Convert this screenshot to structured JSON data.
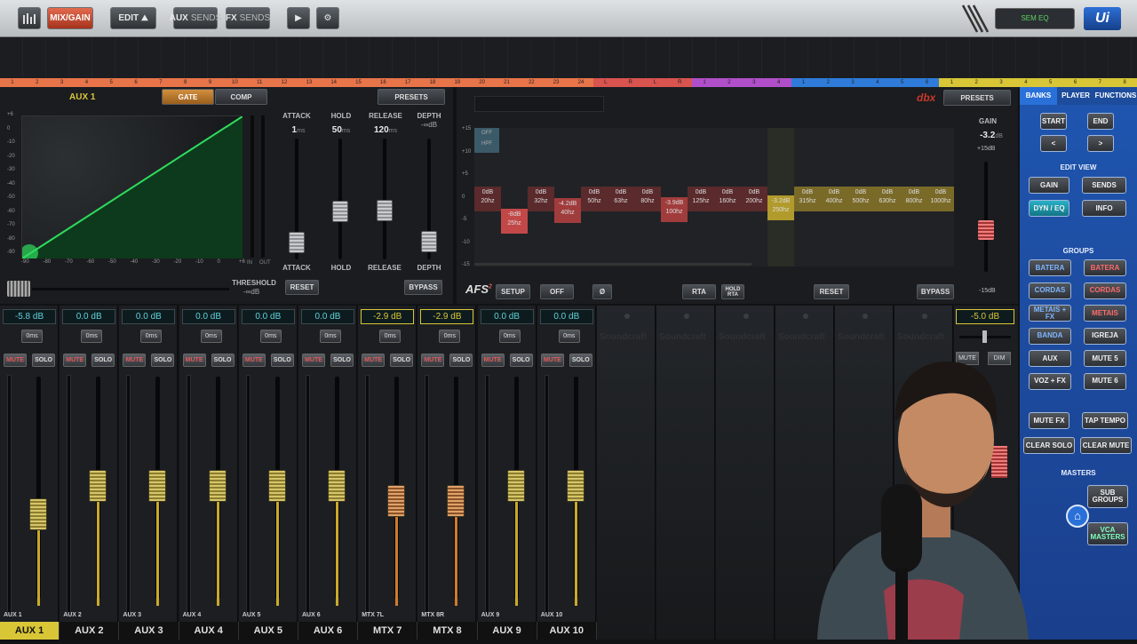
{
  "topbar": {
    "mix_label": "MIX/GAIN",
    "edit_label": "EDIT",
    "aux_label": "AUX",
    "aux_sends_label": "SENDS",
    "fx_label": "FX",
    "fx_sends_label": "SENDS",
    "scene_label": "SEM EQ",
    "logo": "Ui"
  },
  "channel_numbers": [
    "1",
    "2",
    "3",
    "4",
    "5",
    "6",
    "7",
    "8",
    "9",
    "10",
    "11",
    "12",
    "13",
    "14",
    "15",
    "16",
    "17",
    "18",
    "19",
    "20",
    "21",
    "22",
    "23",
    "24",
    "L",
    "R",
    "L",
    "R",
    "1",
    "2",
    "3",
    "4",
    "1",
    "2",
    "3",
    "4",
    "5",
    "6",
    "1",
    "2",
    "3",
    "4",
    "5",
    "6",
    "7",
    "8"
  ],
  "dynamics": {
    "channel_title": "AUX 1",
    "tab_gate": "GATE",
    "tab_comp": "COMP",
    "presets": "PRESETS",
    "y_ticks": [
      "+6",
      "0",
      "-10",
      "-20",
      "-30",
      "-40",
      "-50",
      "-60",
      "-70",
      "-80",
      "-90"
    ],
    "x_ticks": [
      "-90",
      "-80",
      "-70",
      "-60",
      "-50",
      "-40",
      "-30",
      "-20",
      "-10",
      "0",
      "+6"
    ],
    "in_label": "IN",
    "out_label": "OUT",
    "attack": {
      "label": "ATTACK",
      "value": "1",
      "unit": "ms"
    },
    "hold": {
      "label": "HOLD",
      "value": "50",
      "unit": "ms"
    },
    "release": {
      "label": "RELEASE",
      "value": "120",
      "unit": "ms"
    },
    "depth": {
      "label": "DEPTH",
      "value": "-∞",
      "unit": "dB"
    },
    "threshold": {
      "label": "THRESHOLD",
      "value": "-∞",
      "unit": "dB"
    },
    "reset": "RESET",
    "bypass": "BYPASS"
  },
  "eq": {
    "brand": "dbx",
    "presets": "PRESETS",
    "hpf_state": "OFF",
    "hpf_label": "HPF",
    "y_ticks": [
      "+15",
      "+10",
      "+5",
      "0",
      "-5",
      "-10",
      "-15"
    ],
    "gain_label": "GAIN",
    "gain_value": "-3.2",
    "gain_unit": "dB",
    "gain_max": "+15dB",
    "gain_min": "-15dB",
    "bands": [
      {
        "gain": "0dB",
        "freq": "20hz"
      },
      {
        "gain": "-8dB",
        "freq": "25hz"
      },
      {
        "gain": "0dB",
        "freq": "32hz"
      },
      {
        "gain": "-4.2dB",
        "freq": "40hz"
      },
      {
        "gain": "0dB",
        "freq": "50hz"
      },
      {
        "gain": "0dB",
        "freq": "63hz"
      },
      {
        "gain": "0dB",
        "freq": "80hz"
      },
      {
        "gain": "-3.9dB",
        "freq": "100hz"
      },
      {
        "gain": "0dB",
        "freq": "125hz"
      },
      {
        "gain": "0dB",
        "freq": "160hz"
      },
      {
        "gain": "0dB",
        "freq": "200hz"
      },
      {
        "gain": "-3.2dB",
        "freq": "250hz"
      },
      {
        "gain": "0dB",
        "freq": "315hz"
      },
      {
        "gain": "0dB",
        "freq": "400hz"
      },
      {
        "gain": "0dB",
        "freq": "500hz"
      },
      {
        "gain": "0dB",
        "freq": "630hz"
      },
      {
        "gain": "0dB",
        "freq": "800hz"
      },
      {
        "gain": "0dB",
        "freq": "1000hz"
      }
    ],
    "afs": "AFS",
    "setup": "SETUP",
    "off": "OFF",
    "phase": "Ø",
    "rta": "RTA",
    "hold_rta": "HOLD RTA",
    "reset": "RESET",
    "bypass": "BYPASS"
  },
  "channels": [
    {
      "level": "-5.8 dB",
      "delay": "0ms",
      "mute": "MUTE",
      "solo": "SOLO",
      "small": "AUX 1",
      "name": "AUX 1",
      "fader": 0.62,
      "highlight": false
    },
    {
      "level": "0.0 dB",
      "delay": "0ms",
      "mute": "MUTE",
      "solo": "SOLO",
      "small": "AUX 2",
      "name": "AUX 2",
      "fader": 0.75,
      "highlight": false
    },
    {
      "level": "0.0 dB",
      "delay": "0ms",
      "mute": "MUTE",
      "solo": "SOLO",
      "small": "AUX 3",
      "name": "AUX 3",
      "fader": 0.75,
      "highlight": false
    },
    {
      "level": "0.0 dB",
      "delay": "0ms",
      "mute": "MUTE",
      "solo": "SOLO",
      "small": "AUX 4",
      "name": "AUX 4",
      "fader": 0.75,
      "highlight": false
    },
    {
      "level": "0.0 dB",
      "delay": "0ms",
      "mute": "MUTE",
      "solo": "SOLO",
      "small": "AUX 5",
      "name": "AUX 5",
      "fader": 0.75,
      "highlight": false
    },
    {
      "level": "0.0 dB",
      "delay": "0ms",
      "mute": "MUTE",
      "solo": "SOLO",
      "small": "AUX 6",
      "name": "AUX 6",
      "fader": 0.75,
      "highlight": false
    },
    {
      "level": "-2.9 dB",
      "delay": "0ms",
      "mute": "MUTE",
      "solo": "SOLO",
      "small": "MTX 7L",
      "name": "MTX 7",
      "fader": 0.68,
      "highlight": true
    },
    {
      "level": "-2.9 dB",
      "delay": "0ms",
      "mute": "MUTE",
      "solo": "SOLO",
      "small": "MTX 8R",
      "name": "MTX 8",
      "fader": 0.68,
      "highlight": true
    },
    {
      "level": "0.0 dB",
      "delay": "0ms",
      "mute": "MUTE",
      "solo": "SOLO",
      "small": "AUX 9",
      "name": "AUX 9",
      "fader": 0.75,
      "highlight": false
    },
    {
      "level": "0.0 dB",
      "delay": "0ms",
      "mute": "MUTE",
      "solo": "SOLO",
      "small": "AUX 10",
      "name": "AUX 10",
      "fader": 0.75,
      "highlight": false
    }
  ],
  "empty_strips_brand": "Soundcraft",
  "master": {
    "level": "-5.0 dB",
    "mute": "MUTE",
    "dim": "DIM"
  },
  "right_panel": {
    "tabs": [
      "BANKS",
      "PLAYER",
      "FUNCTIONS"
    ],
    "start": "START",
    "end": "END",
    "prev": "<",
    "next": ">",
    "edit_view_title": "EDIT VIEW",
    "gain": "GAIN",
    "sends": "SENDS",
    "dyn_eq": "DYN / EQ",
    "info": "INFO",
    "groups_title": "GROUPS",
    "groups": [
      "BATERA",
      "BATERA",
      "CORDAS",
      "CORDAS",
      "METAIS + FX",
      "METAIS",
      "BANDA",
      "IGREJA",
      "AUX",
      "MUTE 5",
      "VOZ + FX",
      "MUTE 6"
    ],
    "mute_fx": "MUTE FX",
    "tap_tempo": "TAP TEMPO",
    "clear_solo": "CLEAR SOLO",
    "clear_mute": "CLEAR MUTE",
    "masters_title": "MASTERS",
    "sub_groups": "SUB GROUPS",
    "vca_masters": "VCA MASTERS"
  },
  "colors": {
    "accent_yellow": "#d9c637",
    "cyan": "#5fd3d8",
    "panel_blue": "#1f56b0",
    "mix_red": "#c9472b"
  }
}
